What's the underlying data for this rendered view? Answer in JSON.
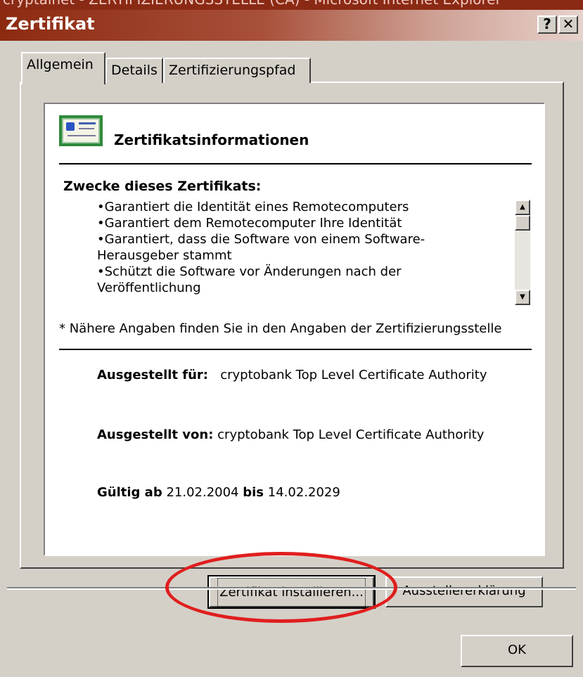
{
  "background_window_title": "cryptainet - ZERTIFIZIERUNGSSTELLE (CA) - Microsoft Internet Explorer",
  "dialog": {
    "title": "Zertifikat",
    "help_button": "?",
    "close_button": "✕"
  },
  "tabs": [
    {
      "label": "Allgemein",
      "active": true
    },
    {
      "label": "Details",
      "active": false
    },
    {
      "label": "Zertifizierungspfad",
      "active": false
    }
  ],
  "info": {
    "heading": "Zertifikatsinformationen",
    "purposes_title": "Zwecke dieses Zertifikats:",
    "purposes": [
      "•Garantiert die Identität eines Remotecomputers",
      "•Garantiert dem Remotecomputer Ihre Identität",
      "•Garantiert, dass die Software von einem Software-",
      "Herausgeber stammt",
      "•Schützt die Software vor Änderungen nach der",
      "Veröffentlichung"
    ],
    "note": "* Nähere Angaben finden Sie in den Angaben der Zertifizierungsstelle",
    "issued_to_label": "Ausgestellt für:",
    "issued_to_value": "cryptobank Top Level Certificate Authority",
    "issued_by_label": "Ausgestellt von:",
    "issued_by_value": "cryptobank Top Level Certificate Authority",
    "valid_from_label": "Gültig ab",
    "valid_from_value": "21.02.2004",
    "valid_to_label": "bis",
    "valid_to_value": "14.02.2029"
  },
  "buttons": {
    "install": "Zertifikat installieren...",
    "issuer_statement": "Ausstellererklärung",
    "ok": "OK"
  },
  "annotation_color": "#e01e1e"
}
